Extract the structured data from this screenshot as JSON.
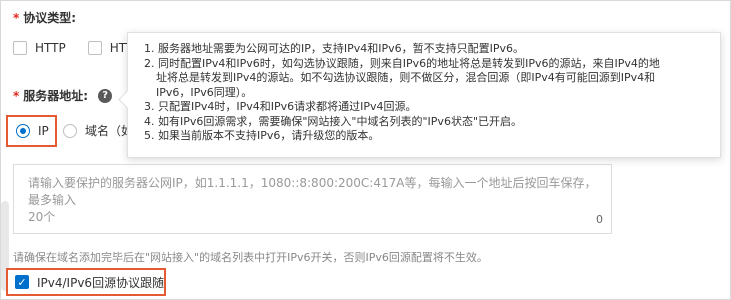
{
  "protocol": {
    "label": "协议类型:",
    "options": [
      {
        "label": "HTTP",
        "checked": false
      },
      {
        "label": "HTTPS",
        "checked": false
      }
    ]
  },
  "server": {
    "label": "服务器地址:",
    "help_icon": "question-circle-icon",
    "radios": [
      {
        "label": "IP",
        "selected": true
      },
      {
        "label": "域名（如",
        "selected": false
      }
    ],
    "textarea_placeholder_line1": "请输入要保护的服务器公网IP，如1.1.1.1，1080::8:800:200C:417A等，每输入一个地址后按回车保存，最多输入",
    "textarea_placeholder_line2": "20个",
    "count": "0"
  },
  "tooltip": {
    "items": [
      "1. 服务器地址需要为公网可达的IP，支持IPv4和IPv6，暂不支持只配置IPv6。",
      "2. 同时配置IPv4和IPv6时，如勾选协议跟随，则来自IPv6的地址将总是转发到IPv6的源站，来自IPv4的地",
      "    址将总是转发到IPv4的源站。如不勾选协议跟随，则不做区分，混合回源（即IPv4有可能回源到IPv4和",
      "    IPv6，IPv6同理）。",
      "3. 只配置IPv4时，IPv4和IPv6请求都将通过IPv4回源。",
      "4. 如有IPv6回源需求，需要确保\"网站接入\"中域名列表的\"IPv6状态\"已开启。",
      "5. 如果当前版本不支持IPv6，请升级您的版本。"
    ]
  },
  "tip_text": "请确保在域名添加完毕后在\"网站接入\"的域名列表中打开IPv6开关，否则IPv6回源配置将不生效。",
  "follow": {
    "label": "IPv4/IPv6回源协议跟随",
    "checked": true
  },
  "colors": {
    "accent": "#0070cc",
    "highlight_border": "#e55a33",
    "required": "#e1251b"
  }
}
